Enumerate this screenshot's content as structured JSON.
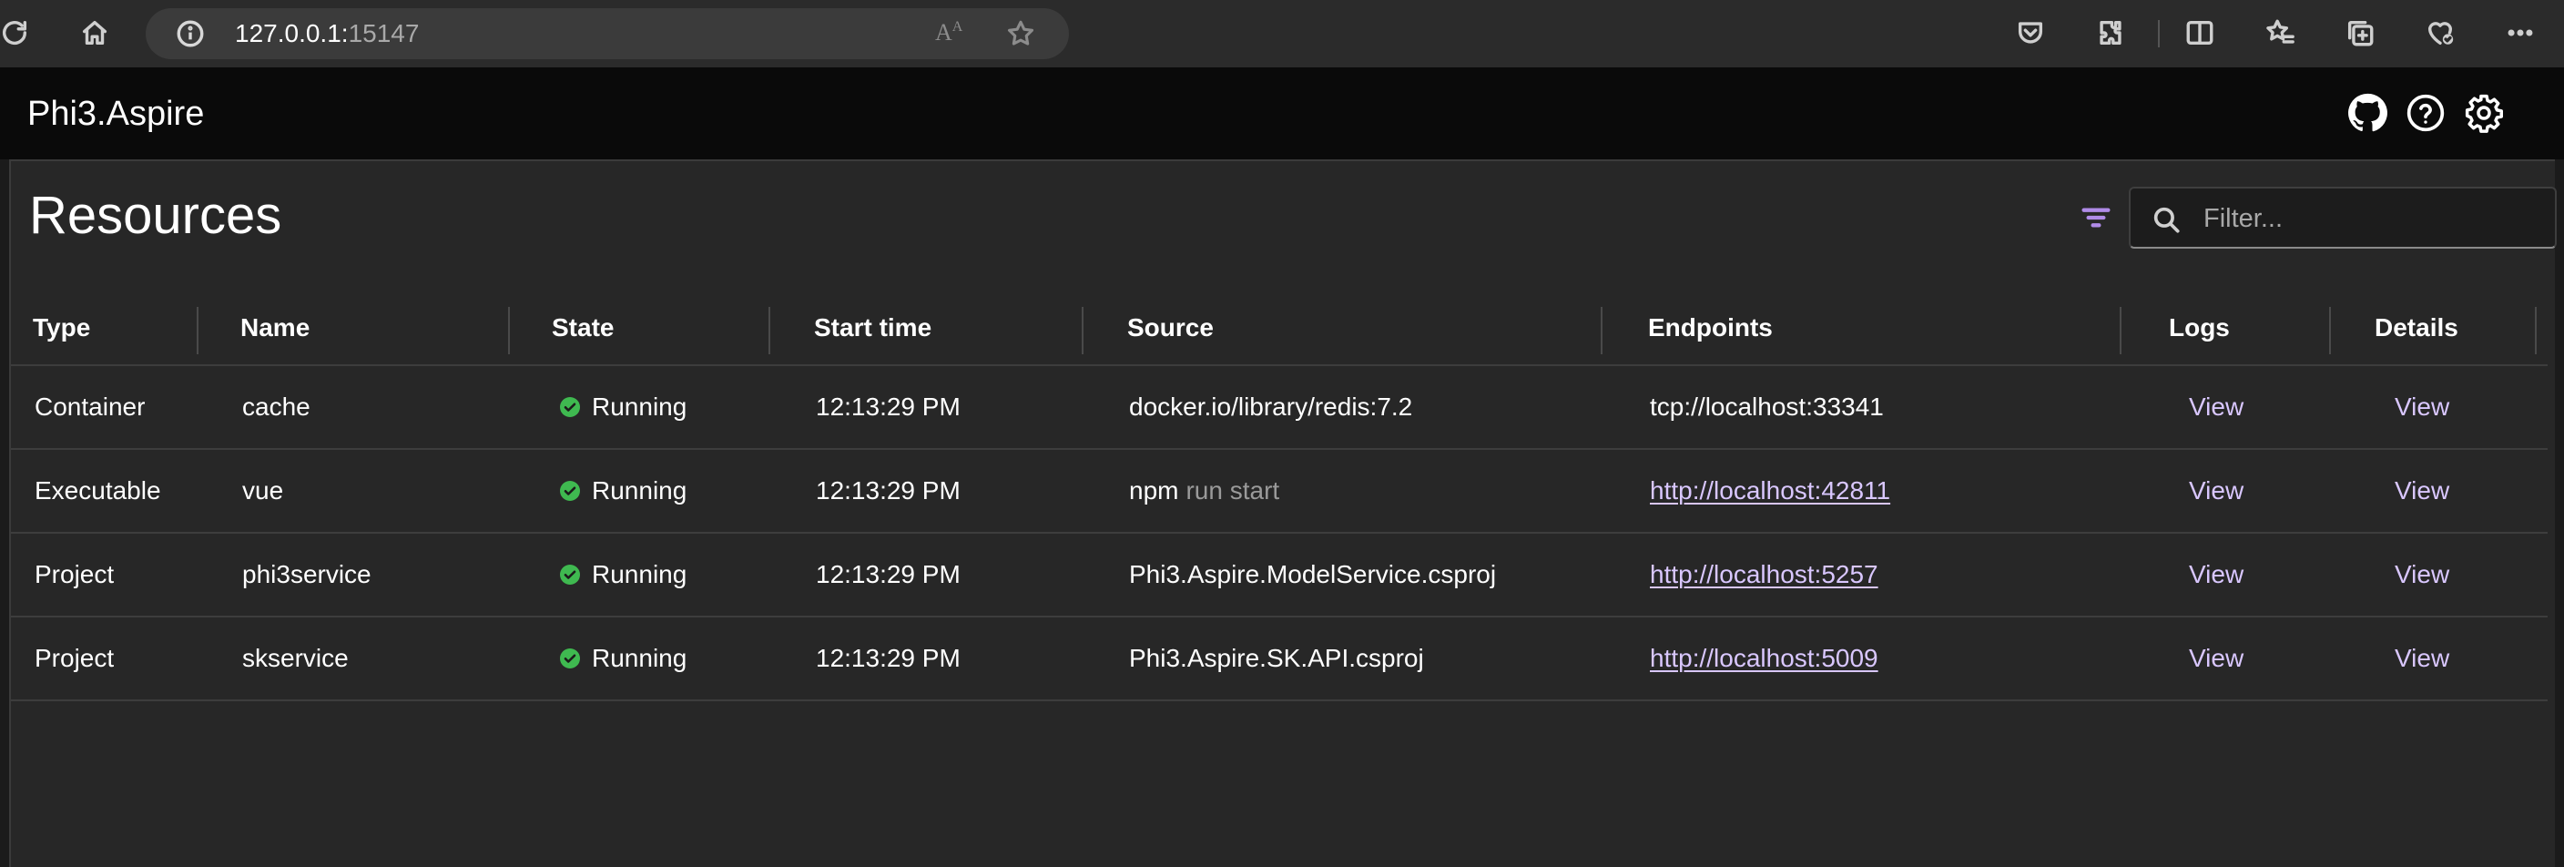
{
  "browser": {
    "url_host": "127.0.0.1:",
    "url_port": "15147",
    "read_aloud_label": "Aᴬ"
  },
  "app": {
    "title": "Phi3.Aspire"
  },
  "page": {
    "title": "Resources",
    "filter_placeholder": "Filter..."
  },
  "grid": {
    "headers": {
      "type": "Type",
      "name": "Name",
      "state": "State",
      "start_time": "Start time",
      "source": "Source",
      "endpoints": "Endpoints",
      "logs": "Logs",
      "details": "Details"
    },
    "rows": [
      {
        "type": "Container",
        "name": "cache",
        "state": "Running",
        "start_time": "12:13:29 PM",
        "source": "docker.io/library/redis:7.2",
        "source_args": "",
        "endpoint": "tcp://localhost:33341",
        "logs": "View",
        "details": "View"
      },
      {
        "type": "Executable",
        "name": "vue",
        "state": "Running",
        "start_time": "12:13:29 PM",
        "source": "npm",
        "source_args": "run start",
        "endpoint": "http://localhost:42811",
        "logs": "View",
        "details": "View"
      },
      {
        "type": "Project",
        "name": "phi3service",
        "state": "Running",
        "start_time": "12:13:29 PM",
        "source": "Phi3.Aspire.ModelService.csproj",
        "source_args": "",
        "endpoint": "http://localhost:5257",
        "logs": "View",
        "details": "View"
      },
      {
        "type": "Project",
        "name": "skservice",
        "state": "Running",
        "start_time": "12:13:29 PM",
        "source": "Phi3.Aspire.SK.API.csproj",
        "source_args": "",
        "endpoint": "http://localhost:5009",
        "logs": "View",
        "details": "View"
      }
    ]
  },
  "colors": {
    "accent": "#b08be8",
    "link": "#d9c7ff",
    "running": "#3fb950"
  }
}
